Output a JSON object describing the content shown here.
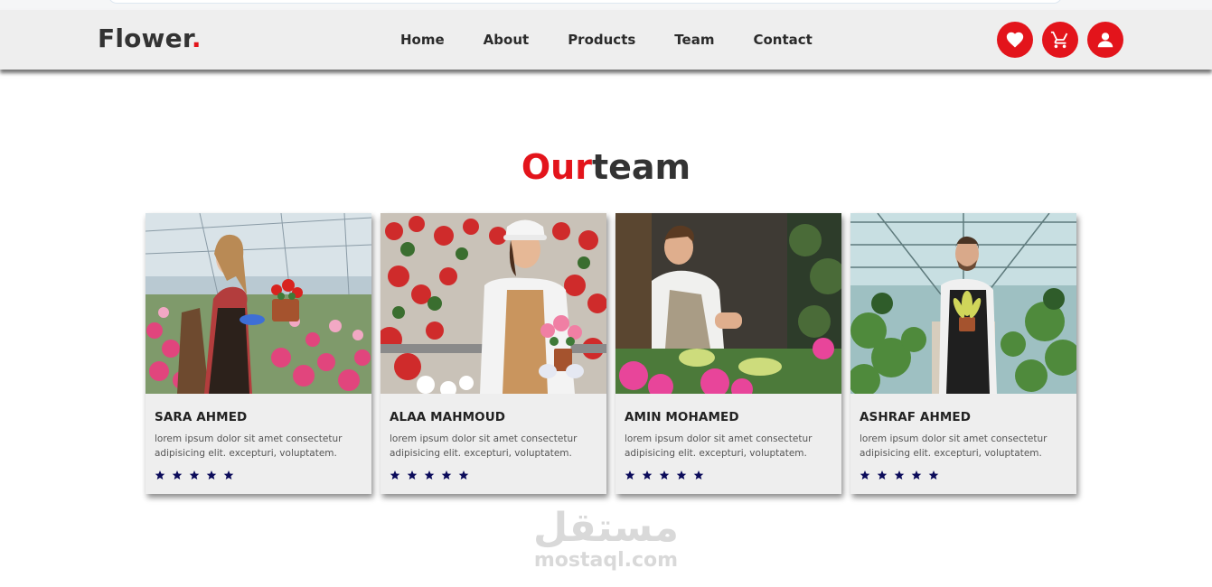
{
  "header": {
    "logo_text": "Flower",
    "logo_dot": ".",
    "nav": [
      "Home",
      "About",
      "Products",
      "Team",
      "Contact"
    ],
    "icons": [
      "heart-icon",
      "cart-icon",
      "user-icon"
    ],
    "accent_color": "#e3141b"
  },
  "team": {
    "title_accent": "Our",
    "title_rest": "team",
    "members": [
      {
        "name": "SARA AHMED",
        "desc": "lorem ipsum dolor sit amet consectetur adipisicing elit. excepturi, voluptatem.",
        "rating": 5
      },
      {
        "name": "ALAA MAHMOUD",
        "desc": "lorem ipsum dolor sit amet consectetur adipisicing elit. excepturi, voluptatem.",
        "rating": 5
      },
      {
        "name": "AMIN MOHAMED",
        "desc": "lorem ipsum dolor sit amet consectetur adipisicing elit. excepturi, voluptatem.",
        "rating": 5
      },
      {
        "name": "ASHRAF AHMED",
        "desc": "lorem ipsum dolor sit amet consectetur adipisicing elit. excepturi, voluptatem.",
        "rating": 5
      }
    ]
  },
  "watermark": {
    "arabic": "مستقل",
    "latin": "mostaql.com"
  }
}
